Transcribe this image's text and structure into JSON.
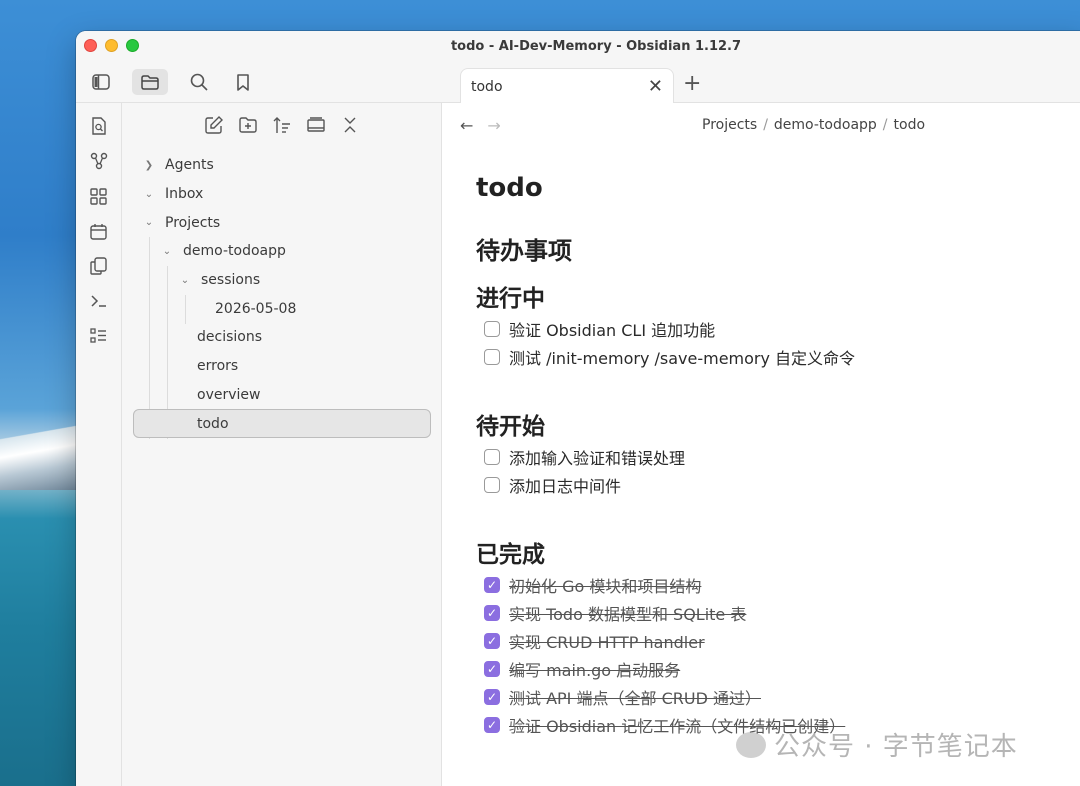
{
  "window": {
    "title": "todo - AI-Dev-Memory - Obsidian 1.12.7"
  },
  "tab": {
    "label": "todo",
    "close": "✕",
    "new": "+"
  },
  "breadcrumb": [
    "Projects",
    "demo-todoapp",
    "todo"
  ],
  "breadcrumb_sep": "/",
  "tree": {
    "agents": "Agents",
    "inbox": "Inbox",
    "projects": "Projects",
    "demo": "demo-todoapp",
    "sessions": "sessions",
    "session_date": "2026-05-08",
    "decisions": "decisions",
    "errors": "errors",
    "overview": "overview",
    "todo": "todo"
  },
  "note": {
    "title": "todo",
    "heading": "待办事项",
    "in_progress": {
      "title": "进行中",
      "tasks": [
        "验证 Obsidian CLI 追加功能",
        "测试 /init-memory /save-memory 自定义命令"
      ]
    },
    "pending": {
      "title": "待开始",
      "tasks": [
        "添加输入验证和错误处理",
        "添加日志中间件"
      ]
    },
    "done": {
      "title": "已完成",
      "tasks": [
        "初始化 Go 模块和项目结构",
        "实现 Todo 数据模型和 SQLite 表",
        "实现 CRUD HTTP handler",
        "编写 main.go 启动服务",
        "测试 API 端点（全部 CRUD 通过）",
        "验证 Obsidian 记忆工作流（文件结构已创建）"
      ]
    }
  },
  "watermark": "公众号 · 字节笔记本",
  "colors": {
    "accent": "#8b6ee0",
    "red": "#fe5f57",
    "yellow": "#febc2e",
    "green": "#28c840"
  }
}
